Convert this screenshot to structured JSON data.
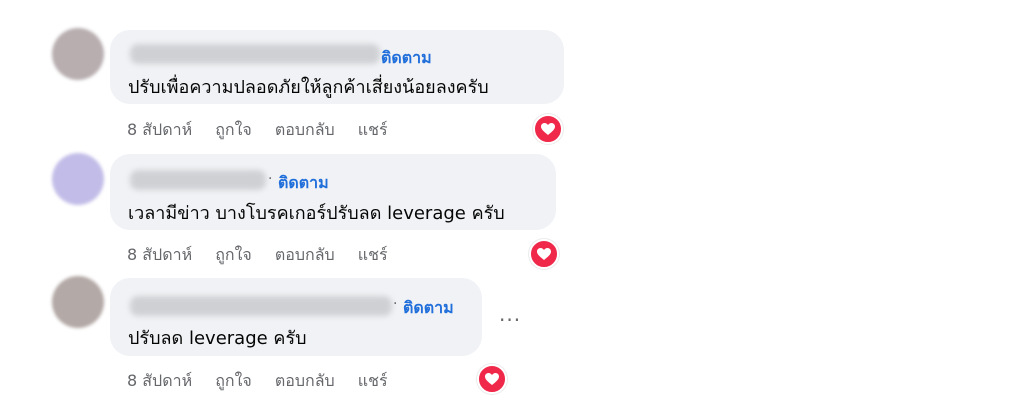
{
  "comments": [
    {
      "follow_label": "ติดตาม",
      "text": "ปรับเพื่อความปลอดภัยให้ลูกค้าเสี่ยงน้อยลงครับ",
      "time": "8 สัปดาห์",
      "like_label": "ถูกใจ",
      "reply_label": "ตอบกลับ",
      "share_label": "แชร์",
      "reaction_icon": "love-reaction-icon",
      "avatar_color": "#b8aeb0"
    },
    {
      "separator": "·",
      "follow_label": "ติดตาม",
      "text": "เวลามีข่าว บางโบรคเกอร์ปรับลด leverage ครับ",
      "time": "8 สัปดาห์",
      "like_label": "ถูกใจ",
      "reply_label": "ตอบกลับ",
      "share_label": "แชร์",
      "reaction_icon": "love-reaction-icon",
      "avatar_color": "#c2bde8"
    },
    {
      "separator": "·",
      "follow_label": "ติดตาม",
      "text": "ปรับลด leverage ครับ",
      "time": "8 สัปดาห์",
      "like_label": "ถูกใจ",
      "reply_label": "ตอบกลับ",
      "share_label": "แชร์",
      "more_label": "...",
      "reaction_icon": "love-reaction-icon",
      "avatar_color": "#b3a9a6"
    }
  ],
  "colors": {
    "follow": "#216fdb",
    "bubble": "#f0f2f5",
    "meta": "#65676b",
    "love": "#f0284a"
  }
}
